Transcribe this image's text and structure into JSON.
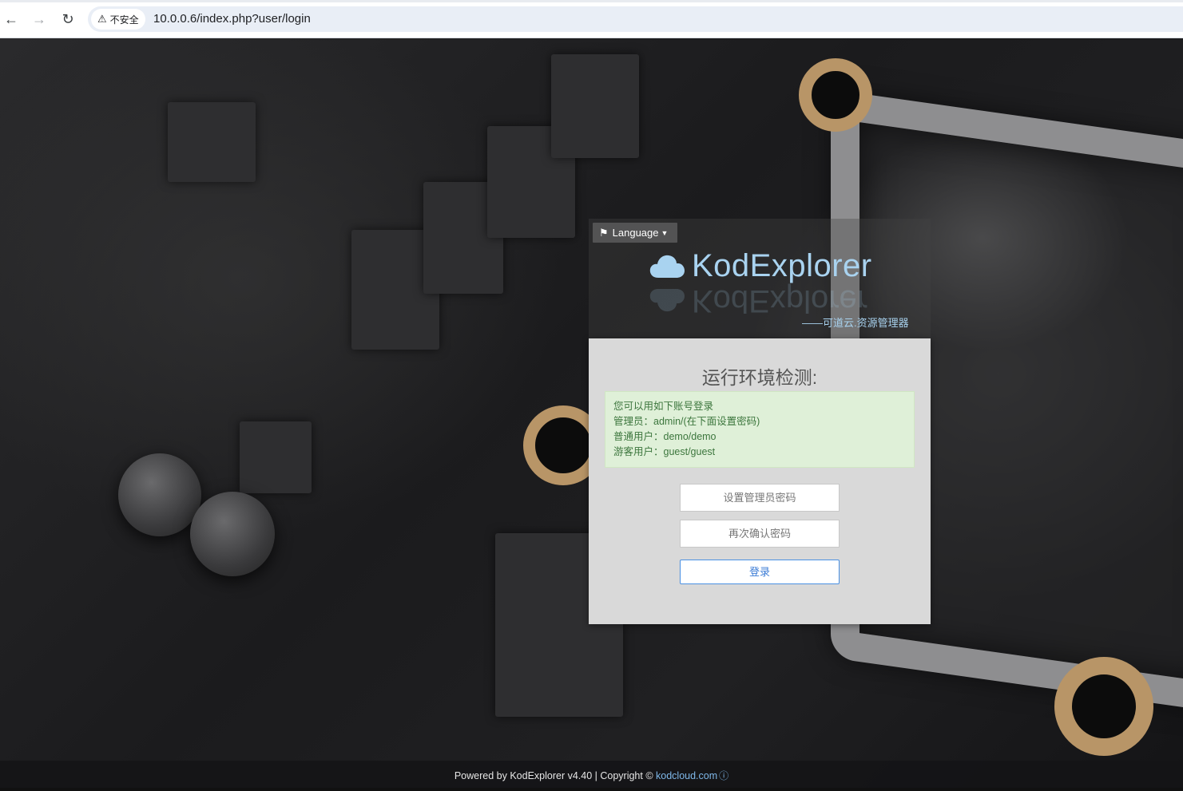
{
  "browser": {
    "security_label": "不安全",
    "url": "10.0.0.6/index.php?user/login"
  },
  "login": {
    "language_label": "Language",
    "app_name": "KodExplorer",
    "subtitle": "——可道云.资源管理器",
    "env_title": "运行环境检测:",
    "notice": {
      "line1": "您可以用如下账号登录",
      "line2": "管理员：admin/(在下面设置密码)",
      "line3": "普通用户：demo/demo",
      "line4": "游客用户：guest/guest"
    },
    "password_placeholder": "设置管理员密码",
    "confirm_placeholder": "再次确认密码",
    "login_button": "登录"
  },
  "footer": {
    "powered": "Powered by KodExplorer v4.40 | Copyright © ",
    "link": "kodcloud.com",
    "info_icon": "info-icon"
  },
  "colors": {
    "accent": "#a9d3f0",
    "alert_bg": "#dff0d8",
    "alert_text": "#3c763d",
    "login_border": "#4a90e2"
  }
}
